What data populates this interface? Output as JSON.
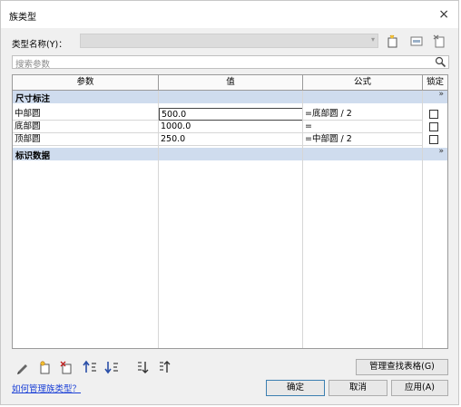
{
  "window": {
    "title": "族类型",
    "close_glyph": "×"
  },
  "type": {
    "label": "类型名称(Y)：",
    "value": ""
  },
  "search": {
    "placeholder": "搜索参数"
  },
  "table": {
    "columns": [
      "参数",
      "值",
      "公式",
      "锁定"
    ],
    "sections": [
      {
        "name": "尺寸标注",
        "collapse_glyph": "»",
        "rows": [
          {
            "param": "中部圆",
            "value": "500.0",
            "formula": "=底部圆 / 2",
            "locked": false
          },
          {
            "param": "底部圆",
            "value": "1000.0",
            "formula": "=",
            "locked": false
          },
          {
            "param": "顶部圆",
            "value": "250.0",
            "formula": "=中部圆 / 2",
            "locked": false
          }
        ]
      },
      {
        "name": "标识数据",
        "collapse_glyph": "»",
        "rows": []
      }
    ]
  },
  "bottom_toolbar": {
    "icons": [
      "pencil-icon",
      "new-param-icon",
      "delete-param-icon",
      "move-up-icon",
      "move-down-icon",
      "sort-ascending-icon",
      "sort-descending-icon"
    ],
    "lookup_label": "管理查找表格(G)"
  },
  "footer": {
    "help_link": "如何管理族类型？",
    "ok": "确定",
    "cancel": "取消",
    "apply": "应用(A)"
  },
  "colors": {
    "section_bg": "#cfdcee",
    "link": "#1a3fd6",
    "ok_border": "#3c7fb1"
  }
}
